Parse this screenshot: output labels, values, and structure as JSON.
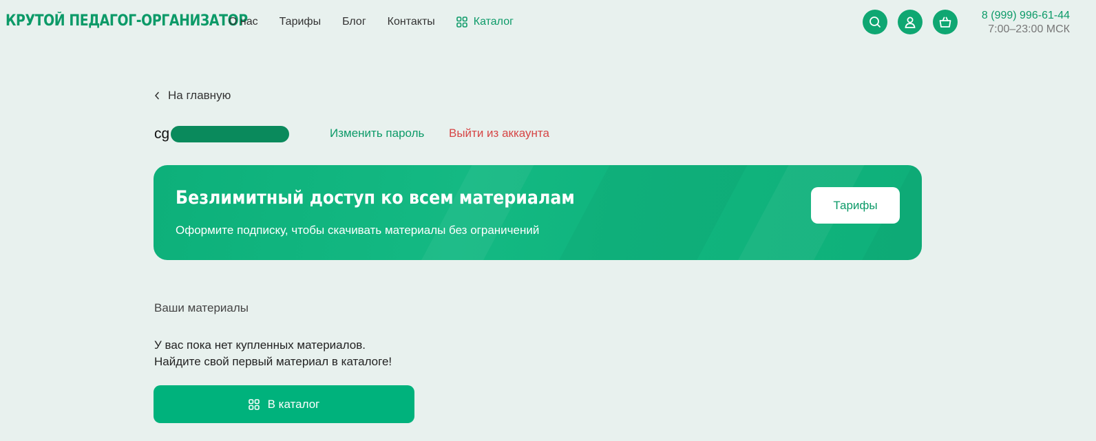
{
  "header": {
    "logo": "КРУТОЙ ПЕДАГОГ-ОРГАНИЗАТОР",
    "nav": [
      "О нас",
      "Тарифы",
      "Блог",
      "Контакты"
    ],
    "catalog_label": "Каталог",
    "icons": [
      "search-icon",
      "user-icon",
      "cart-icon"
    ],
    "phone": "8 (999) 996-61-44",
    "hours": "7:00–23:00 МСК"
  },
  "back_label": "На главную",
  "account": {
    "username_visible": "cg",
    "change_password": "Изменить пароль",
    "logout": "Выйти из аккаунта"
  },
  "banner": {
    "title": "Безлимитный доступ ко всем материалам",
    "subtitle": "Оформите подписку, чтобы скачивать материалы без ограничений",
    "button": "Тарифы"
  },
  "materials": {
    "title": "Ваши материалы",
    "empty_line1": "У вас пока нет купленных материалов.",
    "empty_line2": "Найдите свой первый материал в каталоге!",
    "cta": "В каталог"
  },
  "colors": {
    "brand": "#0c9a68",
    "accent": "#00b27c",
    "danger": "#d64545",
    "background": "#e8f1ee"
  }
}
